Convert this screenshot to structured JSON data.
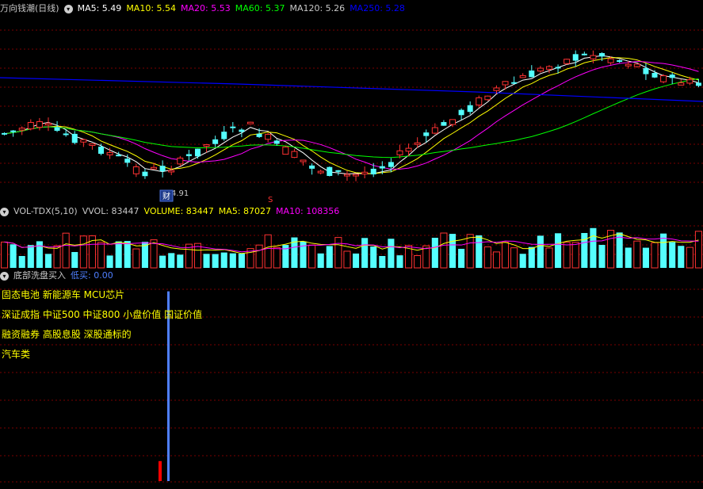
{
  "main": {
    "title": "万向钱潮(日线)",
    "ma": [
      {
        "label": "MA5: 5.49",
        "color": "#ffffff"
      },
      {
        "label": "MA10: 5.54",
        "color": "#ffff00"
      },
      {
        "label": "MA20: 5.53",
        "color": "#ff00ff"
      },
      {
        "label": "MA60: 5.37",
        "color": "#00ff00"
      },
      {
        "label": "MA120: 5.26",
        "color": "#c8c8c8"
      },
      {
        "label": "MA250: 5.28",
        "color": "#0000ff"
      }
    ],
    "low_label": "4.91",
    "finance_marker": "财",
    "s_marker": "S"
  },
  "volume": {
    "title": "VOL-TDX(5,10)",
    "items": [
      {
        "label": "VVOL: 83447",
        "color": "#c8c8c8"
      },
      {
        "label": "VOLUME: 83447",
        "color": "#ffff00"
      },
      {
        "label": "MA5: 87027",
        "color": "#ffff00"
      },
      {
        "label": "MA10: 108356",
        "color": "#ff00ff"
      }
    ]
  },
  "indicator": {
    "title": "底部洗盘买入",
    "buy_label": "低买: 0.00",
    "tags": [
      "固态电池 新能源车 MCU芯片",
      "深证成指 中证500 中证800 小盘价值 国证价值",
      "融资融券 高股息股 深股通标的",
      "汽车类"
    ],
    "signal_levels": {
      "low_buy_red": 0.1,
      "blue_line": 0.95
    }
  },
  "colors": {
    "up": "#ff3232",
    "down": "#54ffff",
    "grid": "#8b0000",
    "bg": "#000000"
  }
}
